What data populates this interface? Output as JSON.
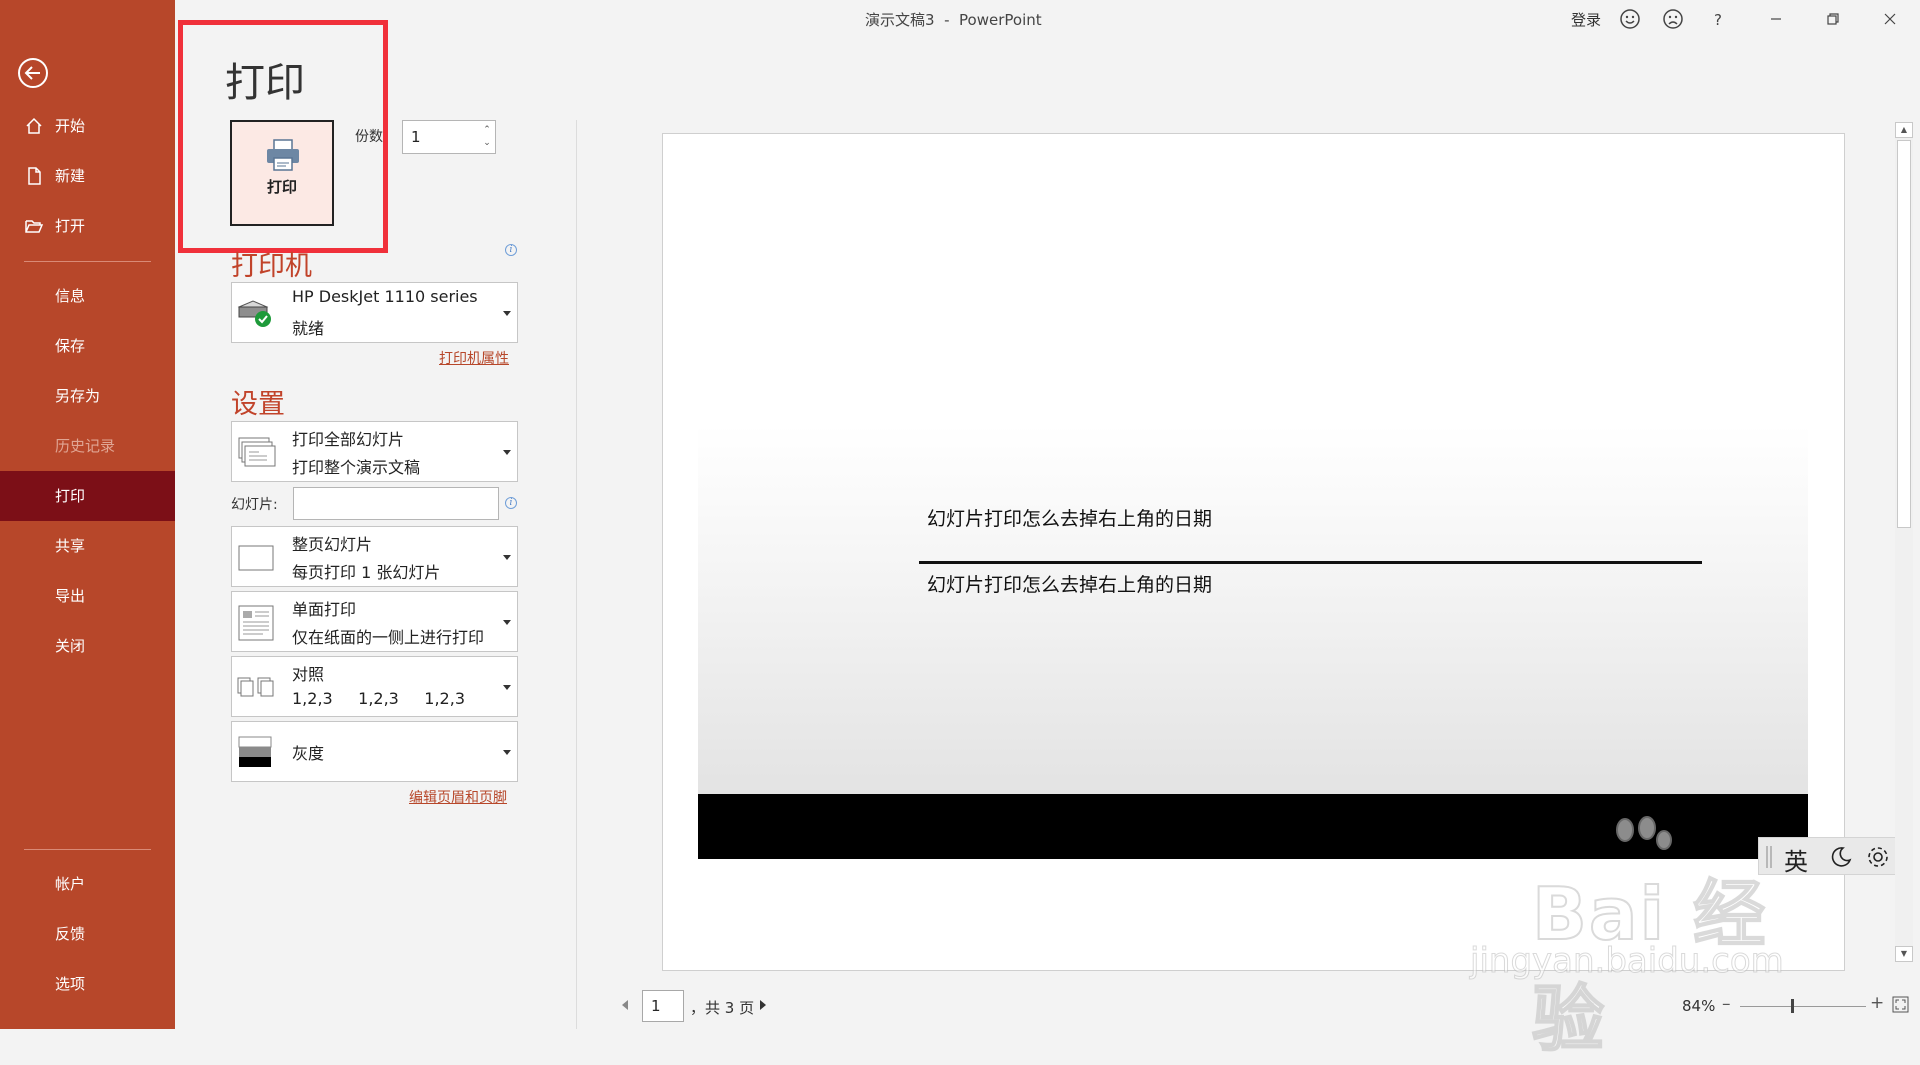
{
  "window": {
    "title": "演示文稿3  -  PowerPoint",
    "signin_label": "登录"
  },
  "nav": {
    "items": [
      {
        "label": "开始",
        "icon": "home-icon"
      },
      {
        "label": "新建",
        "icon": "new-document-icon"
      },
      {
        "label": "打开",
        "icon": "folder-open-icon"
      },
      {
        "label": "信息"
      },
      {
        "label": "保存"
      },
      {
        "label": "另存为"
      },
      {
        "label": "历史记录",
        "disabled": true
      },
      {
        "label": "打印",
        "active": true
      },
      {
        "label": "共享"
      },
      {
        "label": "导出"
      },
      {
        "label": "关闭"
      },
      {
        "label": "帐户"
      },
      {
        "label": "反馈"
      },
      {
        "label": "选项"
      }
    ],
    "colors": {
      "background": "#b7472a",
      "active": "#7c0f17"
    }
  },
  "print": {
    "heading": "打印",
    "print_button_label": "打印",
    "copies_label": "份数",
    "copies_value": "1",
    "printer_section": "打印机",
    "printer_name": "HP DeskJet 1110 series",
    "printer_status": "就绪",
    "printer_properties_link": "打印机属性",
    "settings_section": "设置",
    "range_title": "打印全部幻灯片",
    "range_desc": "打印整个演示文稿",
    "slides_label": "幻灯片:",
    "slides_value": "",
    "layout_title": "整页幻灯片",
    "layout_desc": "每页打印 1 张幻灯片",
    "sides_title": "单面打印",
    "sides_desc": "仅在纸面的一侧上进行打印",
    "collate_title": "对照",
    "collate_desc": "1,2,3     1,2,3     1,2,3",
    "color_title": "灰度",
    "header_footer_link": "编辑页眉和页脚"
  },
  "preview": {
    "slide_title": "幻灯片打印怎么去掉右上角的日期",
    "slide_subtitle": "幻灯片打印怎么去掉右上角的日期",
    "current_page": "1",
    "total_pages_text": "，共 3 页",
    "zoom_level": "84%"
  },
  "overlay": {
    "watermark_text": "Bai  经验",
    "watermark_url": "jingyan.baidu.com",
    "ime_language": "英"
  },
  "accent_color": "#c1432a",
  "highlight_color": "#f0303a"
}
